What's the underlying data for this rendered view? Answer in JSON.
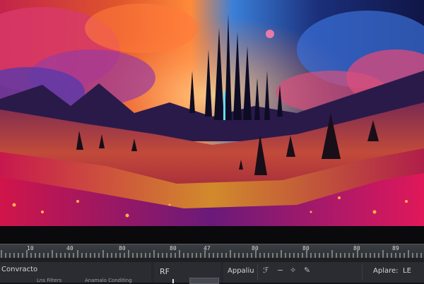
{
  "viewer": {
    "image_name": "fantasy-castle-landscape-icon"
  },
  "timeline": {
    "ruler_labels": [
      "10",
      "40",
      "80",
      "80",
      "47",
      "80",
      "80",
      "80",
      "89"
    ]
  },
  "panels": {
    "left": {
      "label": "Convracto",
      "sub_label_1": "Lns Filters",
      "sub_label_2": "Anamalo Conditing"
    },
    "middle": {
      "label": "RF"
    },
    "right": {
      "label": "Appaliu",
      "icons": [
        "brush-icon",
        "minus-icon",
        "sparkle-icon",
        "eyedropper-icon"
      ],
      "option_label": "Aplare:",
      "option_value": "LE"
    }
  },
  "colors": {
    "panel_bg": "#2a2c31",
    "ruler_bg": "#34373c",
    "accent": "#e0e0e0"
  }
}
